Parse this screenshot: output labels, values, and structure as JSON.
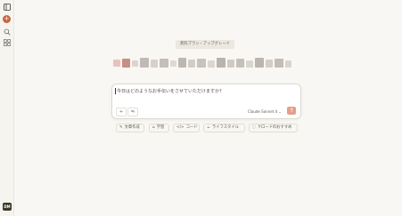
{
  "sidebar": {
    "toggle_icon": "sidebar-toggle-icon",
    "new_chat_glyph": "+",
    "search_icon": "search-icon",
    "projects_icon": "grid-icon",
    "avatar_initials": "DM"
  },
  "header": {
    "plan_badge": "無料プラン・アップグレード"
  },
  "composer": {
    "placeholder": "今日はどのようなお手伝いをさせていただけますか?",
    "attach_glyph": "+",
    "tools_glyph": "⇋",
    "model_label": "Claude Sonnet 4 ⌄",
    "send_glyph": "↑"
  },
  "suggestions": [
    {
      "icon": "pencil-icon",
      "glyph": "✎",
      "label": "文章作成"
    },
    {
      "icon": "cap-icon",
      "glyph": "⌂",
      "label": "学習"
    },
    {
      "icon": "code-icon",
      "glyph": "</>",
      "label": "コード"
    },
    {
      "icon": "coffee-icon",
      "glyph": "☕",
      "label": "ライフスタイル"
    },
    {
      "icon": "bulb-icon",
      "glyph": "◌",
      "label": "クロードのおすすめ"
    }
  ],
  "colors": {
    "background": "#f8f7f3",
    "accent": "#c96442",
    "send_button": "#e3a08a"
  }
}
